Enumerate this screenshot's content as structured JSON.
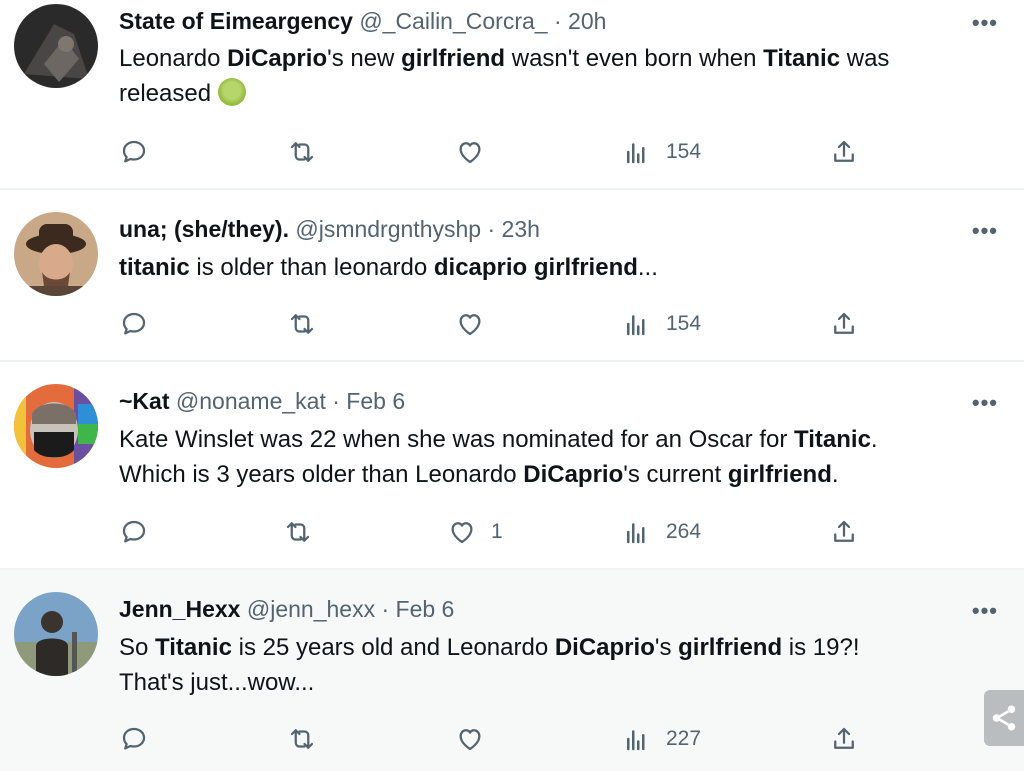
{
  "tweets": [
    {
      "name": "State of Eimeargency",
      "handle": "@_Cailin_Corcra_",
      "time": "20h",
      "text1": "Leonardo ",
      "b1": "DiCaprio",
      "text2": "'s new ",
      "b2": "girlfriend",
      "text3": " wasn't even born when ",
      "b3": "Titanic",
      "text4": " was",
      "line2": "released ",
      "emoji": "nauseated-face-emoji",
      "likes": "",
      "views": "154"
    },
    {
      "name": "una; (she/they).",
      "handle": "@jsmndrgnthyshp",
      "time": "23h",
      "b1": "titanic",
      "text1": " is older than leonardo ",
      "b2": "dicaprio girlfriend",
      "text2": "...",
      "likes": "",
      "views": "154"
    },
    {
      "name": "~Kat",
      "handle": "@noname_kat",
      "time": "Feb 6",
      "text1": "Kate Winslet was 22 when she was nominated for an Oscar for ",
      "b1": "Titanic",
      "text2": ".",
      "text3": "Which is 3 years older than Leonardo ",
      "b2": "DiCaprio",
      "text4": "'s current ",
      "b3": "girlfriend",
      "text5": ".",
      "likes": "1",
      "views": "264"
    },
    {
      "name": "Jenn_Hexx",
      "handle": "@jenn_hexx",
      "time": "Feb 6",
      "text1": "So ",
      "b1": "Titanic",
      "text2": " is 25 years old and Leonardo ",
      "b2": "DiCaprio",
      "text3": "'s ",
      "b3": "girlfriend",
      "text4": " is 19?!",
      "line2": "That's just...wow...",
      "likes": "",
      "views": "227"
    }
  ],
  "separator": "·",
  "more_label": "•••",
  "icons": {
    "reply": "reply-icon",
    "retweet": "retweet-icon",
    "like": "heart-icon",
    "views": "views-icon",
    "share": "share-icon"
  }
}
